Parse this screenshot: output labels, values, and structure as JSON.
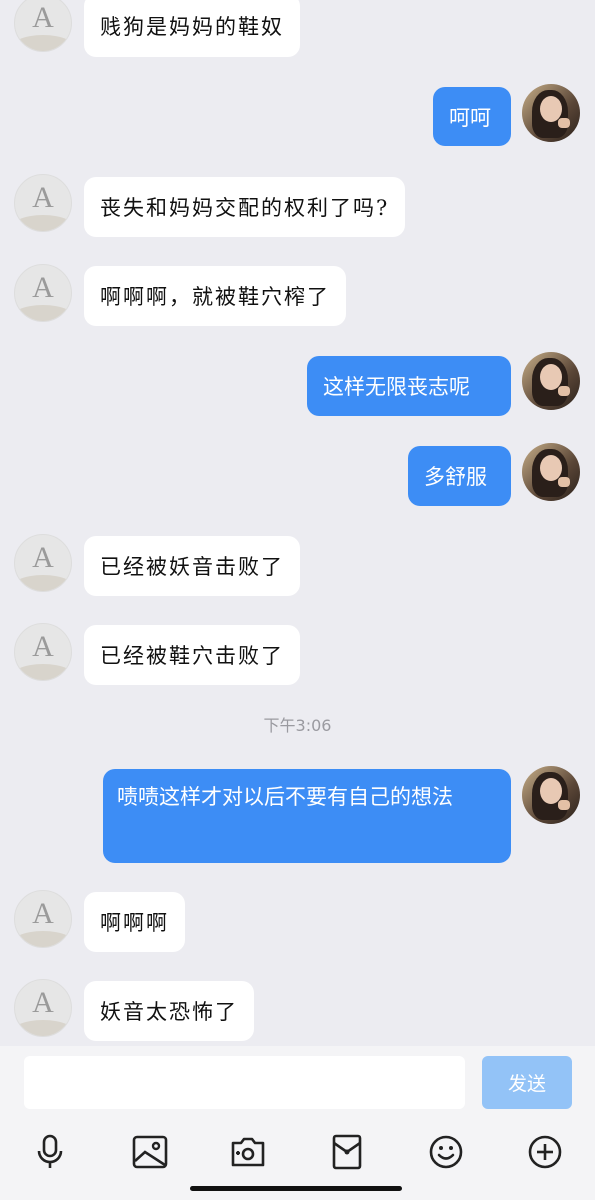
{
  "messages": [
    {
      "side": "left",
      "text": "贱狗是妈妈的鞋奴"
    },
    {
      "side": "right",
      "text": "呵呵"
    },
    {
      "side": "left",
      "text": "丧失和妈妈交配的权利了吗?"
    },
    {
      "side": "left",
      "text": "啊啊啊，就被鞋穴榨了"
    },
    {
      "side": "right",
      "text": "这样无限丧志呢"
    },
    {
      "side": "right",
      "text": "多舒服"
    },
    {
      "side": "left",
      "text": "已经被妖音击败了"
    },
    {
      "side": "left",
      "text": "已经被鞋穴击败了"
    },
    {
      "side": "right",
      "text": "啧啧这样才对以后不要有自己的想法"
    },
    {
      "side": "left",
      "text": "啊啊啊"
    },
    {
      "side": "left",
      "text": "妖音太恐怖了"
    }
  ],
  "timestamp": "下午3:06",
  "composer": {
    "input_value": "",
    "send_label": "发送"
  },
  "toolbar_icons": [
    "microphone-icon",
    "image-icon",
    "camera-icon",
    "red-packet-icon",
    "emoji-icon",
    "plus-icon"
  ],
  "colors": {
    "background": "#ececf1",
    "outgoing_bubble": "#3d8df5",
    "incoming_bubble": "#ffffff",
    "send_button_disabled": "#93c3f7"
  }
}
